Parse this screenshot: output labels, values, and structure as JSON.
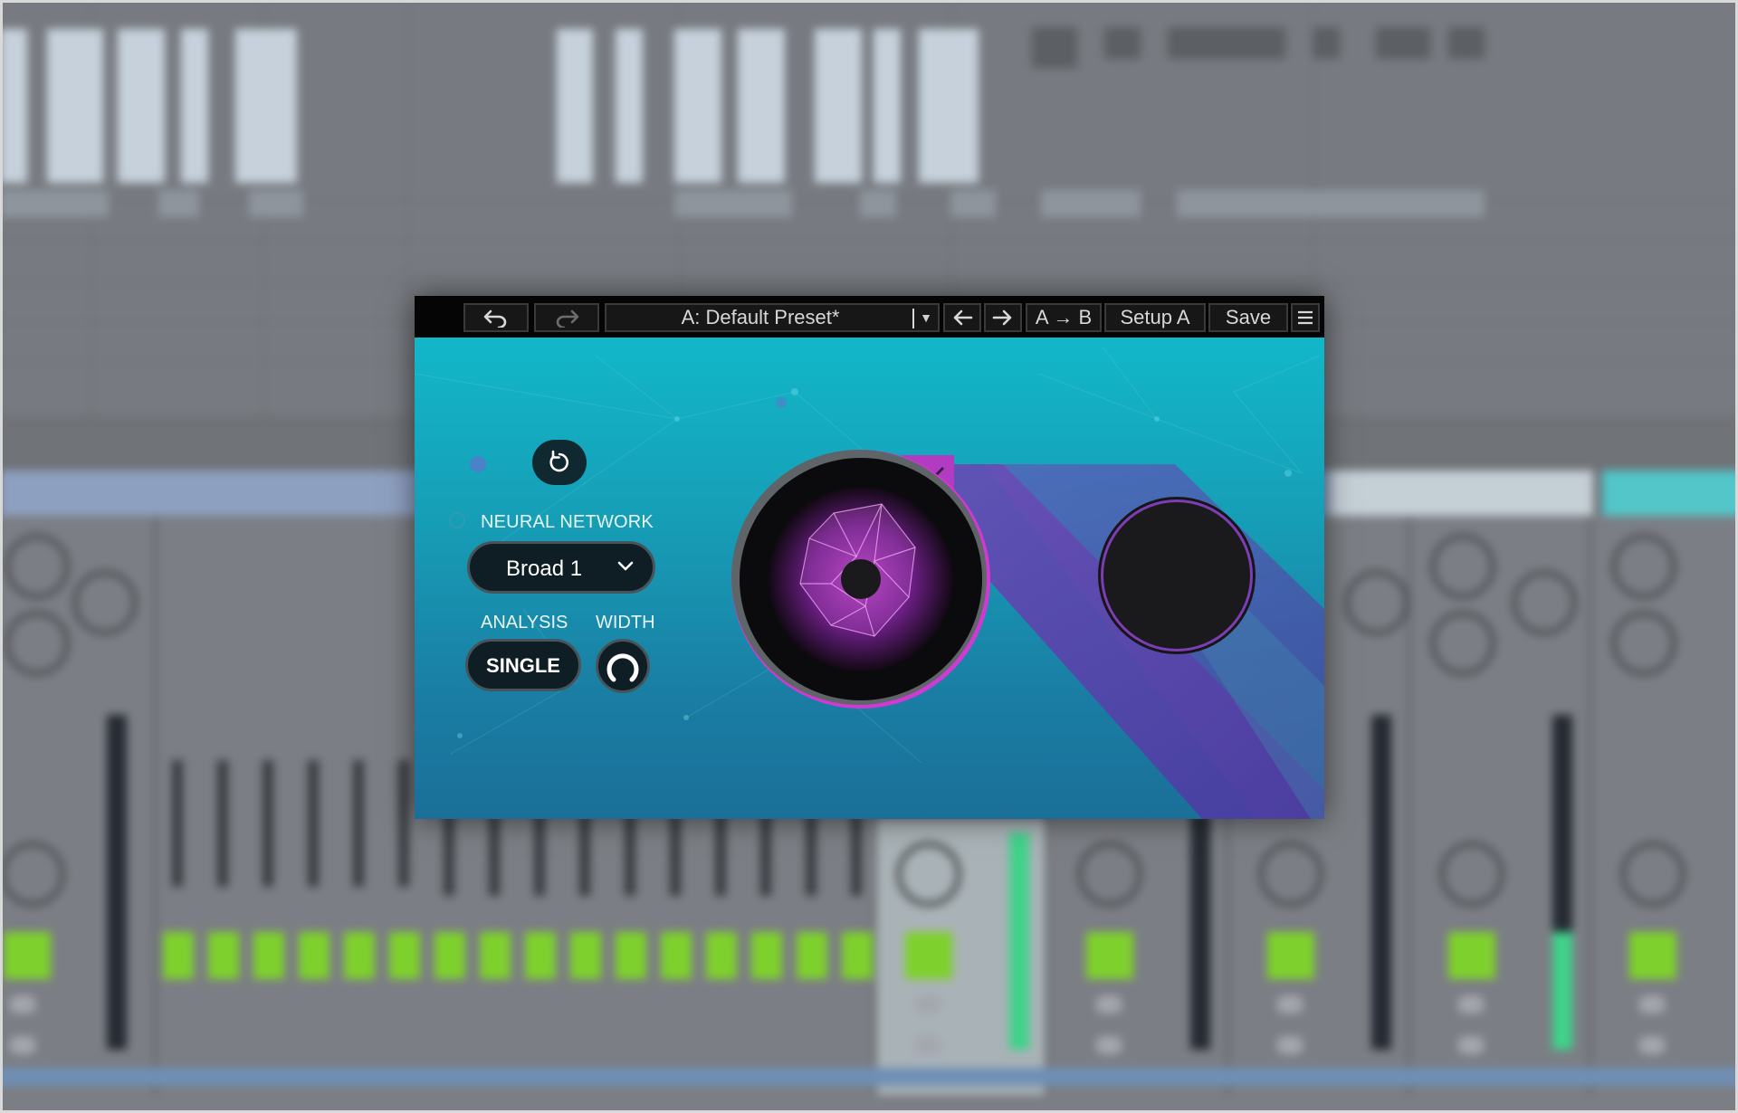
{
  "plugin": {
    "toolbar": {
      "undo_icon": "undo-icon",
      "redo_icon": "redo-icon",
      "preset_name": "A: Default Preset*",
      "preset_dropdown_icon": "triangle-down-icon",
      "prev_icon": "arrow-left-icon",
      "next_icon": "arrow-right-icon",
      "copy_ab_label": "A → B",
      "setup_label": "Setup A",
      "save_label": "Save",
      "menu_icon": "hamburger-icon"
    },
    "controls": {
      "reset_icon": "reset-icon",
      "neural_network_label": "NEURAL NETWORK",
      "neural_network_value": "Broad 1",
      "analysis_label": "ANALYSIS",
      "analysis_value": "SINGLE",
      "width_label": "WIDTH"
    },
    "colors": {
      "accent_magenta": "#d23bd6",
      "background_teal": "#12b7c9",
      "background_purple": "#5a3a9e",
      "control_dark": "#0f1d24"
    }
  }
}
